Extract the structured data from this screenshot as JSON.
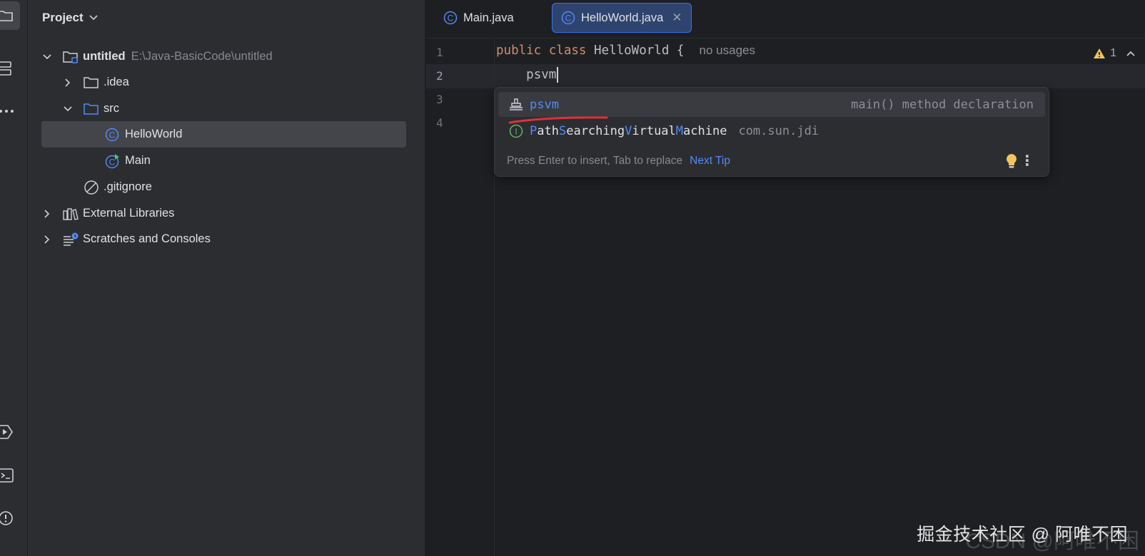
{
  "project_panel": {
    "title": "Project",
    "tree": [
      {
        "label": "untitled",
        "hint": "E:\\Java-BasicCode\\untitled"
      },
      {
        "label": ".idea"
      },
      {
        "label": "src"
      },
      {
        "label": "HelloWorld"
      },
      {
        "label": "Main"
      },
      {
        "label": ".gitignore"
      },
      {
        "label": "External Libraries"
      },
      {
        "label": "Scratches and Consoles"
      }
    ]
  },
  "tabs": [
    {
      "label": "Main.java",
      "active": false
    },
    {
      "label": "HelloWorld.java",
      "active": true
    }
  ],
  "editor": {
    "line_numbers": [
      "1",
      "2",
      "3",
      "4"
    ],
    "line1": {
      "kw1": "public",
      "kw2": "class",
      "name": "HelloWorld",
      "brace": "{",
      "hint": "no usages"
    },
    "line2": {
      "text": "psvm"
    },
    "inspections_count": "1"
  },
  "completion": {
    "items": [
      {
        "match": "psvm",
        "detail": "main() method declaration"
      },
      {
        "parts": [
          "P",
          "ath",
          "S",
          "earching",
          "V",
          "irtual",
          "M",
          "achine"
        ],
        "package": "com.sun.jdi"
      }
    ],
    "footer_text": "Press Enter to insert, Tab to replace",
    "next_tip": "Next Tip"
  },
  "watermark": {
    "text": "掘金技术社区 @ 阿唯不困",
    "faded": "CSDN @阿唯不困"
  },
  "colors": {
    "accent": "#3574f0",
    "keyword": "#cf8e6d",
    "match": "#548af7",
    "background": "#1e1f22",
    "panel": "#2b2d30"
  }
}
